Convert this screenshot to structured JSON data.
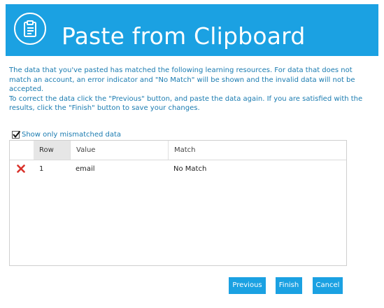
{
  "header": {
    "title": "Paste from Clipboard",
    "icon": "clipboard-icon",
    "color": "#1ba1e2"
  },
  "description": {
    "line1": "The data that you've pasted has matched the following learning resources. For data that does not match an account, an error indicator and \"No Match\" will be shown and the invalid data will not be accepted.",
    "line2": "To correct the data click the \"Previous\" button, and paste the data again. If you are satisfied with the results, click the \"Finish\" button to save your changes."
  },
  "filter": {
    "label": "Show only mismatched data",
    "checked": true
  },
  "grid": {
    "columns": [
      "Row",
      "Value",
      "Match"
    ],
    "rows": [
      {
        "status_icon": "error-x-icon",
        "row": "1",
        "value": "email",
        "match": "No Match"
      }
    ]
  },
  "buttons": {
    "previous": "Previous",
    "finish": "Finish",
    "cancel": "Cancel"
  }
}
